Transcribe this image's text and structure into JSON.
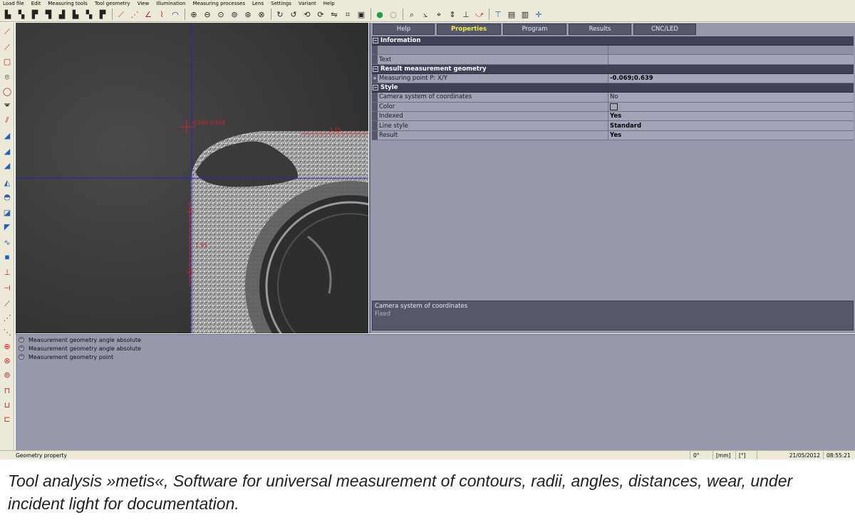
{
  "menu": {
    "items": [
      "Load file",
      "Edit",
      "Measuring tools",
      "Tool geometry",
      "View",
      "Illumination",
      "Measuring processes",
      "Lens",
      "Settings",
      "Variant",
      "Help"
    ]
  },
  "toolbar": {
    "groups": [
      [
        "file-open-icon",
        "save-icon",
        "save-as-icon",
        "print-icon",
        "delete-icon",
        "export-icon",
        "import-icon",
        "report-icon"
      ],
      [
        "line-tool-icon",
        "multi-line-tool-icon",
        "angle-tool-icon",
        "polyline-tool-icon",
        "arc-tool-icon"
      ],
      [
        "zoom-in-icon",
        "zoom-out-icon",
        "zoom-fit-icon",
        "zoom-window-icon",
        "zoom-pan-icon",
        "zoom-previous-icon"
      ],
      [
        "rotate-icon",
        "rotate-180-icon",
        "rotate-left-icon",
        "rotate-right-icon",
        "mirror-icon",
        "crop-icon",
        "snapshot-icon"
      ],
      [
        "green-point-icon",
        "white-point-icon"
      ],
      [
        "search-icon",
        "measure-angle-icon",
        "cross-hair-icon",
        "arrow-split-icon",
        "axis-icon",
        "edge-find-icon"
      ],
      [
        "reference-icon",
        "film-icon",
        "calibrate-icon",
        "move-icon"
      ]
    ]
  },
  "left_toolbar": {
    "icons": [
      "point-icon",
      "line-icon",
      "circle-icon",
      "arc-icon",
      "ellipse-icon",
      "distance-icon",
      "parallel-icon",
      "angle-icon",
      "triangle-icon",
      "slope-icon",
      "ramp-icon",
      "hill-icon",
      "profile-icon",
      "flag-icon",
      "wave-icon",
      "scale-icon",
      "square-icon",
      "width-icon",
      "height-icon",
      "radius-icon",
      "radius-inner-icon",
      "cross-icon",
      "circle-plus-icon",
      "gauge-icon",
      "bracket-top-icon",
      "bracket-bottom-icon",
      "brackets-icon"
    ]
  },
  "camera": {
    "point_label": "-0.069;0.639",
    "dimension_top": "3.15",
    "dimension_left": "1.95"
  },
  "tabs": [
    {
      "label": "Help",
      "active": false
    },
    {
      "label": "Properties",
      "active": true
    },
    {
      "label": "Program",
      "active": false
    },
    {
      "label": "Results",
      "active": false
    },
    {
      "label": "CNC/LED",
      "active": false
    }
  ],
  "properties": {
    "information": {
      "title": "Information",
      "rows": [
        {
          "key": "",
          "value": "",
          "dim": true
        },
        {
          "key": "Text",
          "value": ""
        }
      ]
    },
    "result": {
      "title": "Result measurement geometry",
      "rows": [
        {
          "key": "Measuring point P: X/Y",
          "value": "-0.069;0.639"
        }
      ]
    },
    "style": {
      "title": "Style",
      "rows": [
        {
          "key": "Camera system of coordinates",
          "value": "No"
        },
        {
          "key": "Color",
          "value": ""
        },
        {
          "key": "Indexed",
          "value": "Yes"
        },
        {
          "key": "Line style",
          "value": "Standard"
        },
        {
          "key": "Result",
          "value": "Yes"
        }
      ]
    }
  },
  "description": {
    "title": "Camera system of coordinates",
    "value": "Fixed"
  },
  "geometry_list": [
    "Measurement geometry angle absolute",
    "Measurement geometry angle absolute",
    "Measurement geometry point"
  ],
  "status": {
    "left": "Geometry property",
    "angle": "0°",
    "unit_length": "[mm]",
    "unit_angle": "[°]",
    "date": "21/05/2012",
    "time": "08:55:21"
  },
  "caption": "Tool analysis »metis«, Software for universal measurement of contours, radii, angles, distances, wear, under incident light for documentation.",
  "colors": {
    "panel": "#9698ab",
    "section_header": "#3f4156",
    "tab_active_text": "#f4ee3a",
    "crosshair": "#2222cc",
    "annotation": "#d42020"
  }
}
